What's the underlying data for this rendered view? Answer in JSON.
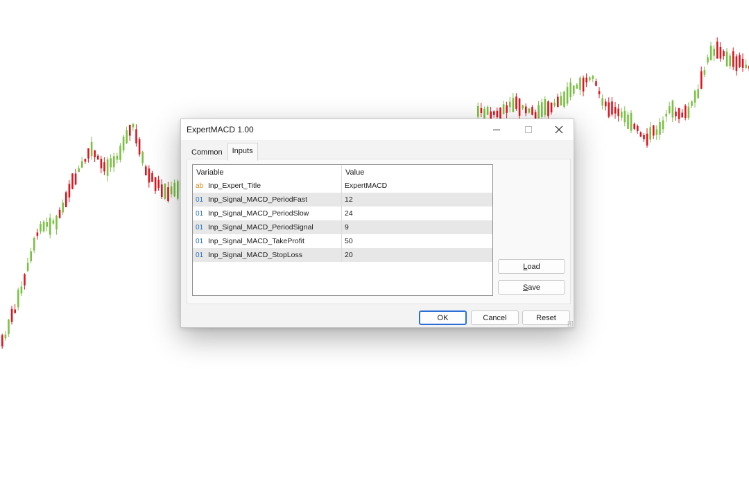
{
  "dialog": {
    "title": "ExpertMACD 1.00",
    "tabs": [
      {
        "label": "Common",
        "active": false
      },
      {
        "label": "Inputs",
        "active": true
      }
    ],
    "table": {
      "headers": {
        "variable": "Variable",
        "value": "Value"
      },
      "rows": [
        {
          "type": "string",
          "type_glyph": "ab",
          "variable": "Inp_Expert_Title",
          "value": "ExpertMACD"
        },
        {
          "type": "int",
          "type_glyph": "01",
          "variable": "Inp_Signal_MACD_PeriodFast",
          "value": "12"
        },
        {
          "type": "int",
          "type_glyph": "01",
          "variable": "Inp_Signal_MACD_PeriodSlow",
          "value": "24"
        },
        {
          "type": "int",
          "type_glyph": "01",
          "variable": "Inp_Signal_MACD_PeriodSignal",
          "value": "9"
        },
        {
          "type": "int",
          "type_glyph": "01",
          "variable": "Inp_Signal_MACD_TakeProfit",
          "value": "50"
        },
        {
          "type": "int",
          "type_glyph": "01",
          "variable": "Inp_Signal_MACD_StopLoss",
          "value": "20"
        }
      ]
    },
    "buttons": {
      "load": {
        "mnemonic": "L",
        "rest": "oad"
      },
      "save": {
        "mnemonic": "S",
        "rest": "ave"
      },
      "ok": "OK",
      "cancel": "Cancel",
      "reset": "Reset"
    },
    "window_controls": [
      "minimize-icon",
      "maximize-icon",
      "close-icon"
    ]
  },
  "colors": {
    "candle_up": "#7ac143",
    "candle_down": "#e0141e",
    "string_icon": "#d08a1c",
    "int_icon": "#2a6fb8",
    "ok_border": "#2b6fd6"
  }
}
